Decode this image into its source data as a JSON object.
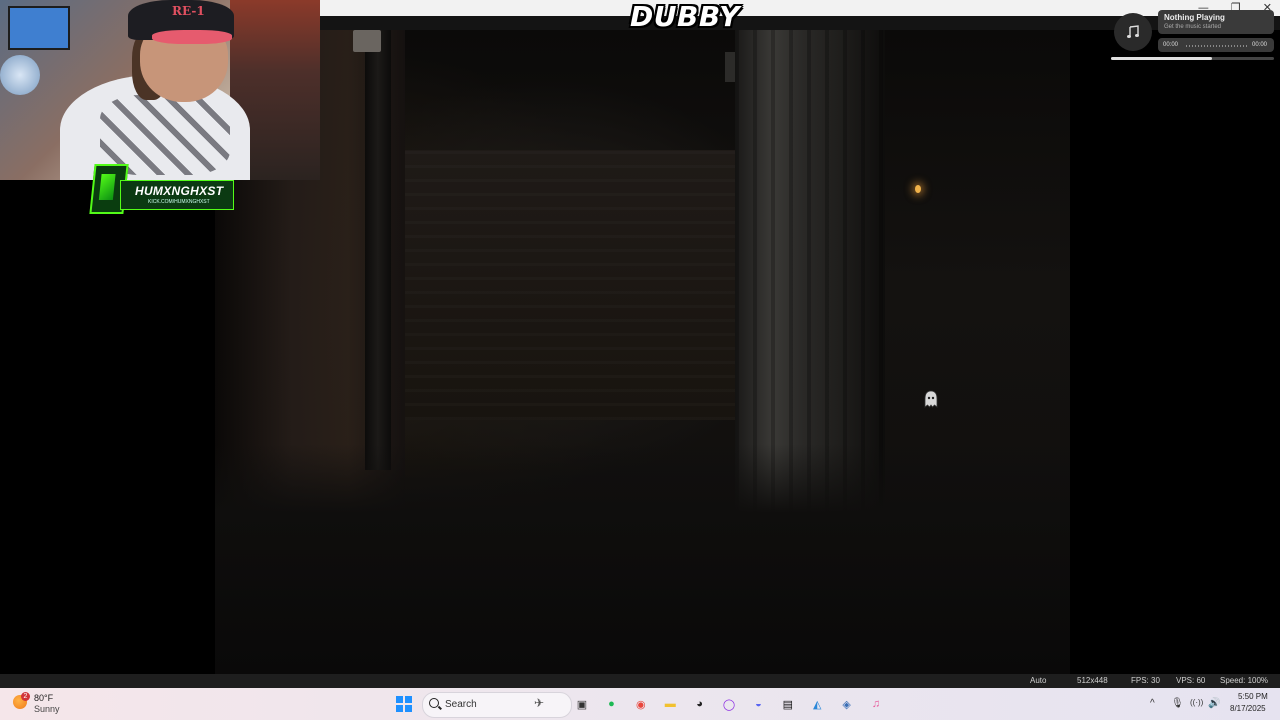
{
  "window": {
    "controls": [
      "—",
      "❐",
      "✕"
    ]
  },
  "stream": {
    "title": "DUBBY",
    "webcam": {
      "hat_text": "RE-1"
    },
    "kick_badge": {
      "name": "HUMXNGHXST",
      "url": "KICK.COM/HUMXNGHXST"
    }
  },
  "music_widget": {
    "icon": "music-note-icon",
    "title": "Nothing Playing",
    "subtitle": "Get the music started",
    "time_elapsed": "00:00",
    "time_total": "00:00",
    "progress_fraction": 0.62
  },
  "emulator_status": {
    "mode": "Auto",
    "resolution": "512x448",
    "fps": "FPS: 30",
    "vps": "VPS: 60",
    "speed": "Speed: 100%"
  },
  "taskbar": {
    "weather": {
      "temp": "80°F",
      "condition": "Sunny",
      "badge": "2"
    },
    "search_placeholder": "Search",
    "apps": [
      {
        "name": "task-view-icon",
        "glyph": "▣",
        "color": "#333333"
      },
      {
        "name": "spotify-icon",
        "glyph": "●",
        "color": "#1db954"
      },
      {
        "name": "chrome-icon",
        "glyph": "◉",
        "color": "#e8453c"
      },
      {
        "name": "file-explorer-icon",
        "glyph": "▬",
        "color": "#f2c12e"
      },
      {
        "name": "obs-icon",
        "glyph": "◕",
        "color": "#222222"
      },
      {
        "name": "app-circle-icon",
        "glyph": "◯",
        "color": "#8a2be2"
      },
      {
        "name": "discord-icon",
        "glyph": "◒",
        "color": "#5865f2"
      },
      {
        "name": "terminal-icon",
        "glyph": "▤",
        "color": "#111111"
      },
      {
        "name": "photos-icon",
        "glyph": "◭",
        "color": "#2b88d8"
      },
      {
        "name": "tools-icon",
        "glyph": "◈",
        "color": "#3b6fb6"
      },
      {
        "name": "itunes-icon",
        "glyph": "♫",
        "color": "#e85a9b"
      }
    ],
    "tray": {
      "chevron": "^",
      "mic": "🎙",
      "wifi": "((·))",
      "volume": "🔊"
    },
    "clock": {
      "time": "5:50 PM",
      "date": "8/17/2025"
    }
  }
}
